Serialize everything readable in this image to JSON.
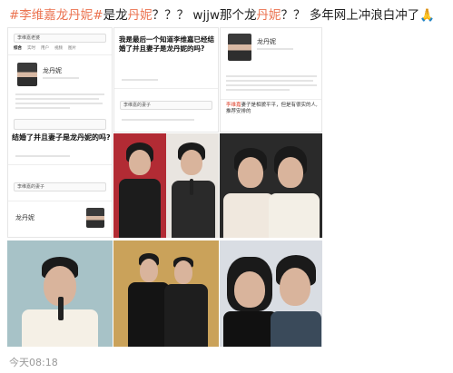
{
  "post": {
    "hashtag1": "#李维嘉龙丹妮#",
    "text1": "是龙",
    "hl1": "丹妮",
    "text2": "？？？ wjjw那个龙",
    "hl2": "丹妮",
    "text3": "？？ 多年网上冲浪白冲了",
    "emoji": "🙏",
    "timestamp": "今天08:18"
  },
  "shot1": {
    "search_value": "李维嘉老婆",
    "tabs": [
      "综合",
      "实时",
      "用户",
      "视频",
      "图片",
      "资讯"
    ],
    "name": "龙丹妮",
    "question": "结婚了并且妻子是龙丹妮的吗?",
    "search_value2": "李维嘉的妻子",
    "name2": "龙丹妮"
  },
  "shot2": {
    "question": "我是最后一个知道李维嘉已经结婚了并且妻子是龙丹妮的吗?",
    "search_value": "李维嘉的妻子"
  },
  "shot3": {
    "name": "龙丹妮",
    "answer_prefix": "李维嘉",
    "answer_mid": "妻子是相貌平平，但是有很",
    "answer_suffix": "实的人,推荐安排的"
  }
}
